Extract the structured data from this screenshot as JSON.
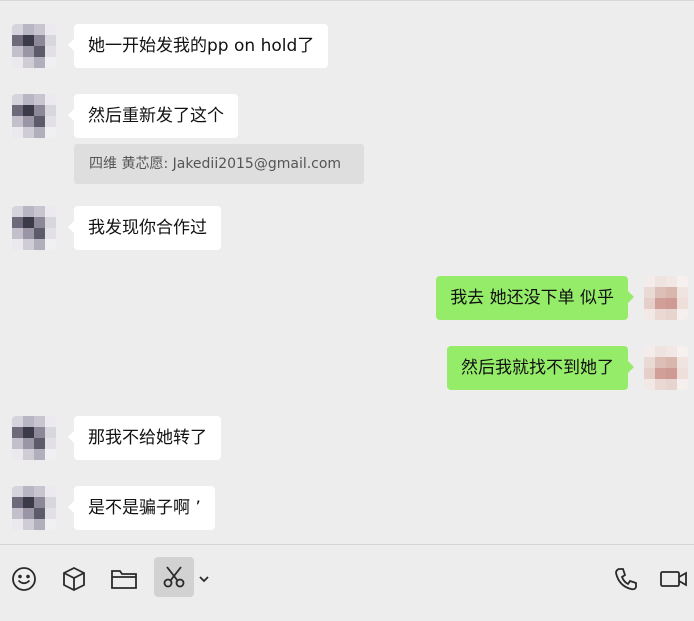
{
  "messages": [
    {
      "side": "left",
      "text": "她一开始发我的pp on hold了"
    },
    {
      "side": "left",
      "text": "然后重新发了这个"
    },
    {
      "side": "left",
      "text": "我发现你合作过"
    },
    {
      "side": "right",
      "text": "我去 她还没下单 似乎"
    },
    {
      "side": "right",
      "text": "然后我就找不到她了"
    },
    {
      "side": "left",
      "text": "那我不给她转了"
    },
    {
      "side": "left",
      "text": "是不是骗子啊 ’"
    }
  ],
  "quote": {
    "text": "四维 黄芯愿: Jakedii2015@gmail.com"
  },
  "toolbar": {
    "icons": [
      "emoji-icon",
      "package-icon",
      "folder-icon",
      "scissors-icon",
      "chevron-down-icon",
      "phone-icon",
      "video-icon"
    ]
  },
  "colors": {
    "background": "#ededed",
    "left_bubble": "#ffffff",
    "right_bubble": "#95ec69"
  }
}
